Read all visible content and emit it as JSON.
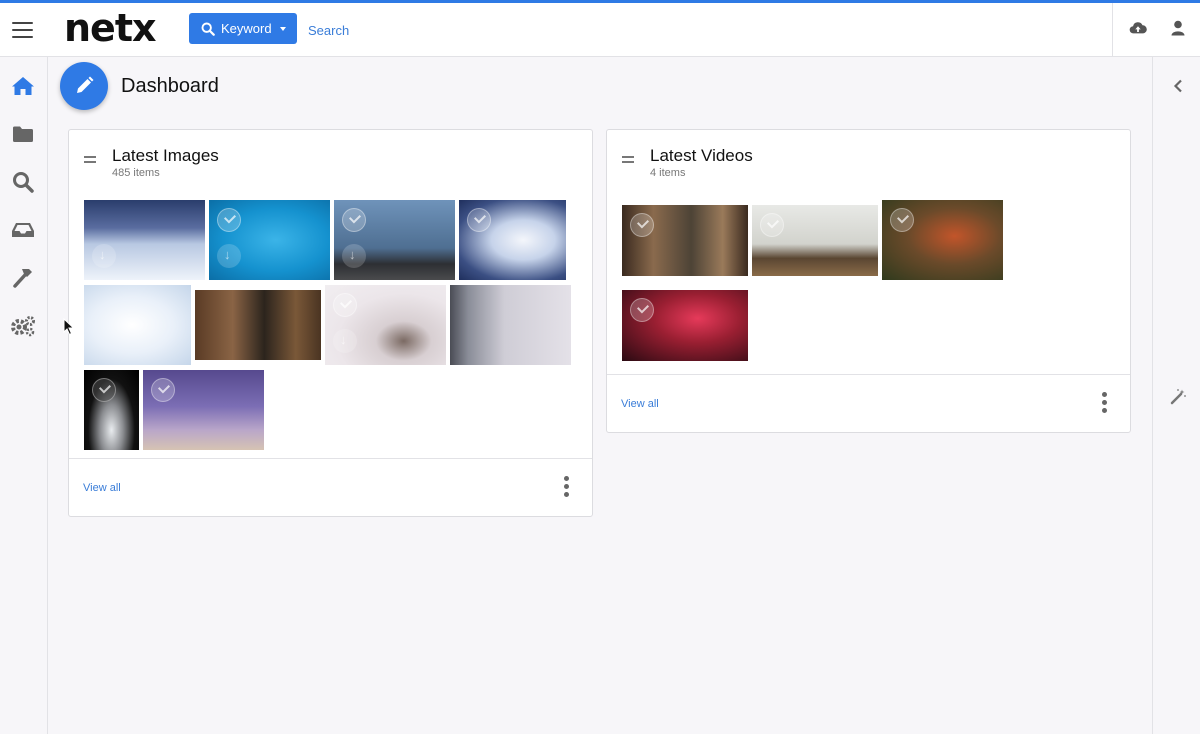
{
  "app": {
    "logo": "netx"
  },
  "search": {
    "mode_label": "Keyword",
    "placeholder": "Search"
  },
  "page": {
    "title": "Dashboard"
  },
  "cards": {
    "images": {
      "title": "Latest Images",
      "count": "485 items",
      "view_all": "View all"
    },
    "videos": {
      "title": "Latest Videos",
      "count": "4 items",
      "view_all": "View all"
    }
  },
  "nav": {
    "items": [
      "home-icon",
      "folder-icon",
      "search-icon",
      "inbox-icon",
      "hammer-icon",
      "gears-icon"
    ]
  },
  "colors": {
    "accent": "#2f7ae5",
    "link": "#3a7dd8"
  }
}
